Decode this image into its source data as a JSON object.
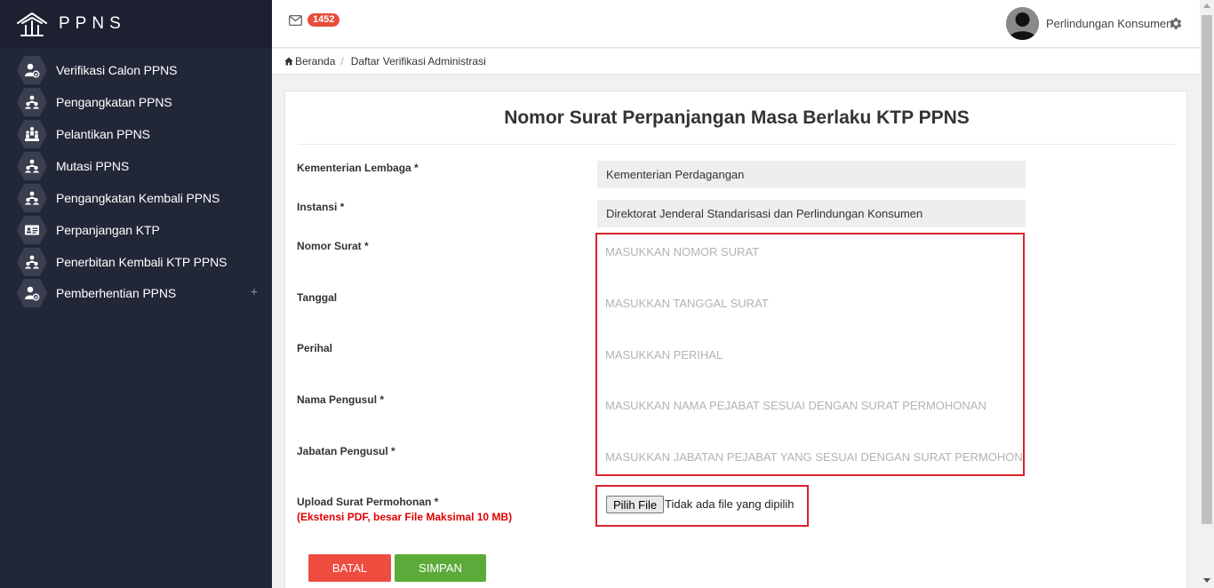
{
  "brand": {
    "name": "PPNS"
  },
  "sidebar": {
    "items": [
      {
        "label": "Verifikasi Calon PPNS",
        "icon": "user-check-icon"
      },
      {
        "label": "Pengangkatan PPNS",
        "icon": "users-group-icon"
      },
      {
        "label": "Pelantikan PPNS",
        "icon": "people-crowd-icon"
      },
      {
        "label": "Mutasi PPNS",
        "icon": "users-group-icon"
      },
      {
        "label": "Pengangkatan Kembali PPNS",
        "icon": "users-group-icon"
      },
      {
        "label": "Perpanjangan KTP",
        "icon": "id-card-icon"
      },
      {
        "label": "Penerbitan Kembali KTP PPNS",
        "icon": "users-group-icon"
      },
      {
        "label": "Pemberhentian PPNS",
        "icon": "user-check-icon",
        "expand": "+"
      }
    ]
  },
  "topbar": {
    "mail_count": "1452",
    "user_name": "Perlindungan Konsumen"
  },
  "breadcrumb": {
    "home": "Beranda",
    "current": "Daftar Verifikasi Administrasi"
  },
  "form": {
    "title": "Nomor Surat Perpanjangan Masa Berlaku KTP PPNS",
    "kementerian": {
      "label": "Kementerian Lembaga *",
      "value": "Kementerian Perdagangan"
    },
    "instansi": {
      "label": "Instansi *",
      "value": "Direktorat Jenderal Standarisasi dan Perlindungan Konsumen"
    },
    "nomor_surat": {
      "label": "Nomor Surat *",
      "placeholder": "MASUKKAN NOMOR SURAT",
      "value": ""
    },
    "tanggal": {
      "label": "Tanggal",
      "placeholder": "MASUKKAN TANGGAL SURAT",
      "value": ""
    },
    "perihal": {
      "label": "Perihal",
      "placeholder": "MASUKKAN PERIHAL",
      "value": ""
    },
    "nama_pengusul": {
      "label": "Nama Pengusul *",
      "placeholder": "MASUKKAN NAMA PEJABAT SESUAI DENGAN SURAT PERMOHONAN",
      "value": ""
    },
    "jabatan_pengusul": {
      "label": "Jabatan Pengusul *",
      "placeholder": "MASUKKAN JABATAN PEJABAT YANG SESUAI DENGAN SURAT PERMOHONAN",
      "value": ""
    },
    "upload": {
      "label": "Upload Surat Permohonan *",
      "note": "(Ekstensi PDF, besar File Maksimal 10 MB)",
      "button": "Pilih File",
      "status": "Tidak ada file yang dipilih"
    },
    "cancel_label": "BATAL",
    "save_label": "SIMPAN"
  },
  "colors": {
    "sidebar_bg": "#222738",
    "highlight_border": "#d9232d",
    "cancel_button": "#ef4c40",
    "save_button": "#5cab3a",
    "badge": "#e74c3c"
  }
}
